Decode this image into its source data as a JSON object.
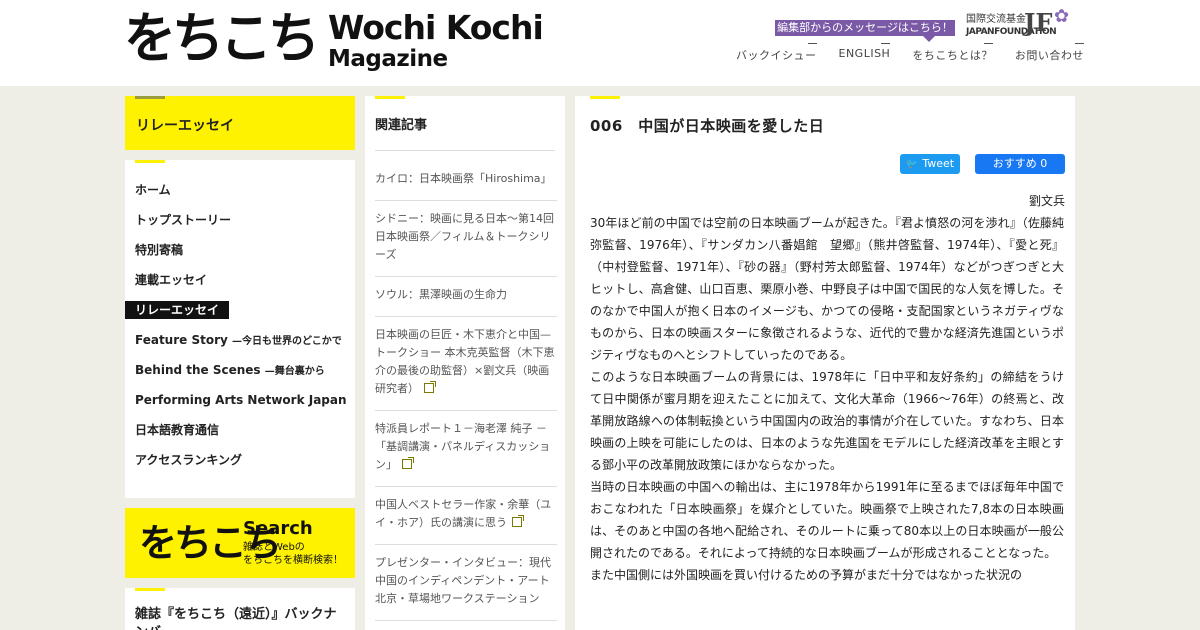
{
  "header": {
    "logo_jp": "をちこち",
    "logo_en_1": "Wochi Kochi",
    "logo_en_2": "Magazine",
    "message_banner": "編集部からのメッセージはこちら！",
    "jf_line1": "国際交流基金",
    "jf_line2": "JAPANFOUNDATION",
    "jf_mark": "JF",
    "nav": [
      "バックイシュー",
      "ENGLISH",
      "をちこちとは？",
      "お問い合わせ"
    ]
  },
  "sidebar": {
    "section_title": "リレーエッセイ",
    "menu": [
      {
        "label": "ホーム",
        "sub": ""
      },
      {
        "label": "トップストーリー",
        "sub": ""
      },
      {
        "label": "特別寄稿",
        "sub": ""
      },
      {
        "label": "連載エッセイ",
        "sub": ""
      },
      {
        "label": "リレーエッセイ",
        "sub": ""
      },
      {
        "label": "Feature Story",
        "sub": "—今日も世界のどこかで"
      },
      {
        "label": "Behind the Scenes",
        "sub": "—舞台裏から"
      },
      {
        "label": "Performing Arts Network Japan",
        "sub": ""
      },
      {
        "label": "日本語教育通信",
        "sub": ""
      },
      {
        "label": "アクセスランキング",
        "sub": ""
      }
    ],
    "search": {
      "logo": "をちこち",
      "title": "Search",
      "sub1": "雑誌とWebの",
      "sub2": "をちこちを横断検索！"
    },
    "backissue_title": "雑誌『をちこち（遠近）』バックナンバー"
  },
  "related": {
    "title": "関連記事",
    "items": [
      {
        "text": "カイロ：日本映画祭「Hiroshima」",
        "external": false
      },
      {
        "text": "シドニー：映画に見る日本～第14回日本映画祭／フィルム＆トークシリーズ",
        "external": false
      },
      {
        "text": "ソウル：黒澤映画の生命力",
        "external": false
      },
      {
        "text": "日本映画の巨匠・木下恵介と中国—トークショー 本木克英監督（木下恵介の最後の助監督）×劉文兵（映画研究者）",
        "external": true
      },
      {
        "text": "特派員レポート１－海老澤 純子 － 「基調講演・パネルディスカッション」",
        "external": true
      },
      {
        "text": "中国人ベストセラー作家・余華（ユイ・ホア）氏の講演に思う",
        "external": true
      },
      {
        "text": "プレゼンター・インタビュー：現代中国のインディペンデント・アート　北京・草場地ワークステーション",
        "external": false
      }
    ]
  },
  "article": {
    "title": "006　中国が日本映画を愛した日",
    "tweet_label": "Tweet",
    "fb_label": "おすすめ 0",
    "author": "劉文兵",
    "paragraphs": [
      "30年ほど前の中国では空前の日本映画ブームが起きた。『君よ憤怒の河を渉れ』（佐藤純弥監督、1976年）、『サンダカン八番娼館　望郷』（熊井啓監督、1974年）、『愛と死』（中村登監督、1971年）、『砂の器』（野村芳太郎監督、1974年）などがつぎつぎと大ヒットし、高倉健、山口百恵、栗原小巻、中野良子は中国で国民的な人気を博した。そのなかで中国人が抱く日本のイメージも、かつての侵略・支配国家というネガティヴなものから、日本の映画スターに象徴されるような、近代的で豊かな経済先進国というポジティヴなものへとシフトしていったのである。",
      "このような日本映画ブームの背景には、1978年に「日中平和友好条約」の締結をうけて日中関係が蜜月期を迎えたことに加えて、文化大革命（1966～76年）の終焉と、改革開放路線への体制転換という中国国内の政治的事情が介在していた。すなわち、日本映画の上映を可能にしたのは、日本のような先進国をモデルにした経済改革を主眼とする鄧小平の改革開放政策にほかならなかった。",
      "当時の日本映画の中国への輸出は、主に1978年から1991年に至るまでほぼ毎年中国でおこなわれた「日本映画祭」を媒介としていた。映画祭で上映された7,8本の日本映画は、そのあと中国の各地へ配給され、そのルートに乗って80本以上の日本映画が一般公開されたのである。それによって持続的な日本映画ブームが形成されることとなった。",
      "また中国側には外国映画を買い付けるための予算がまだ十分ではなかった状況の"
    ]
  }
}
